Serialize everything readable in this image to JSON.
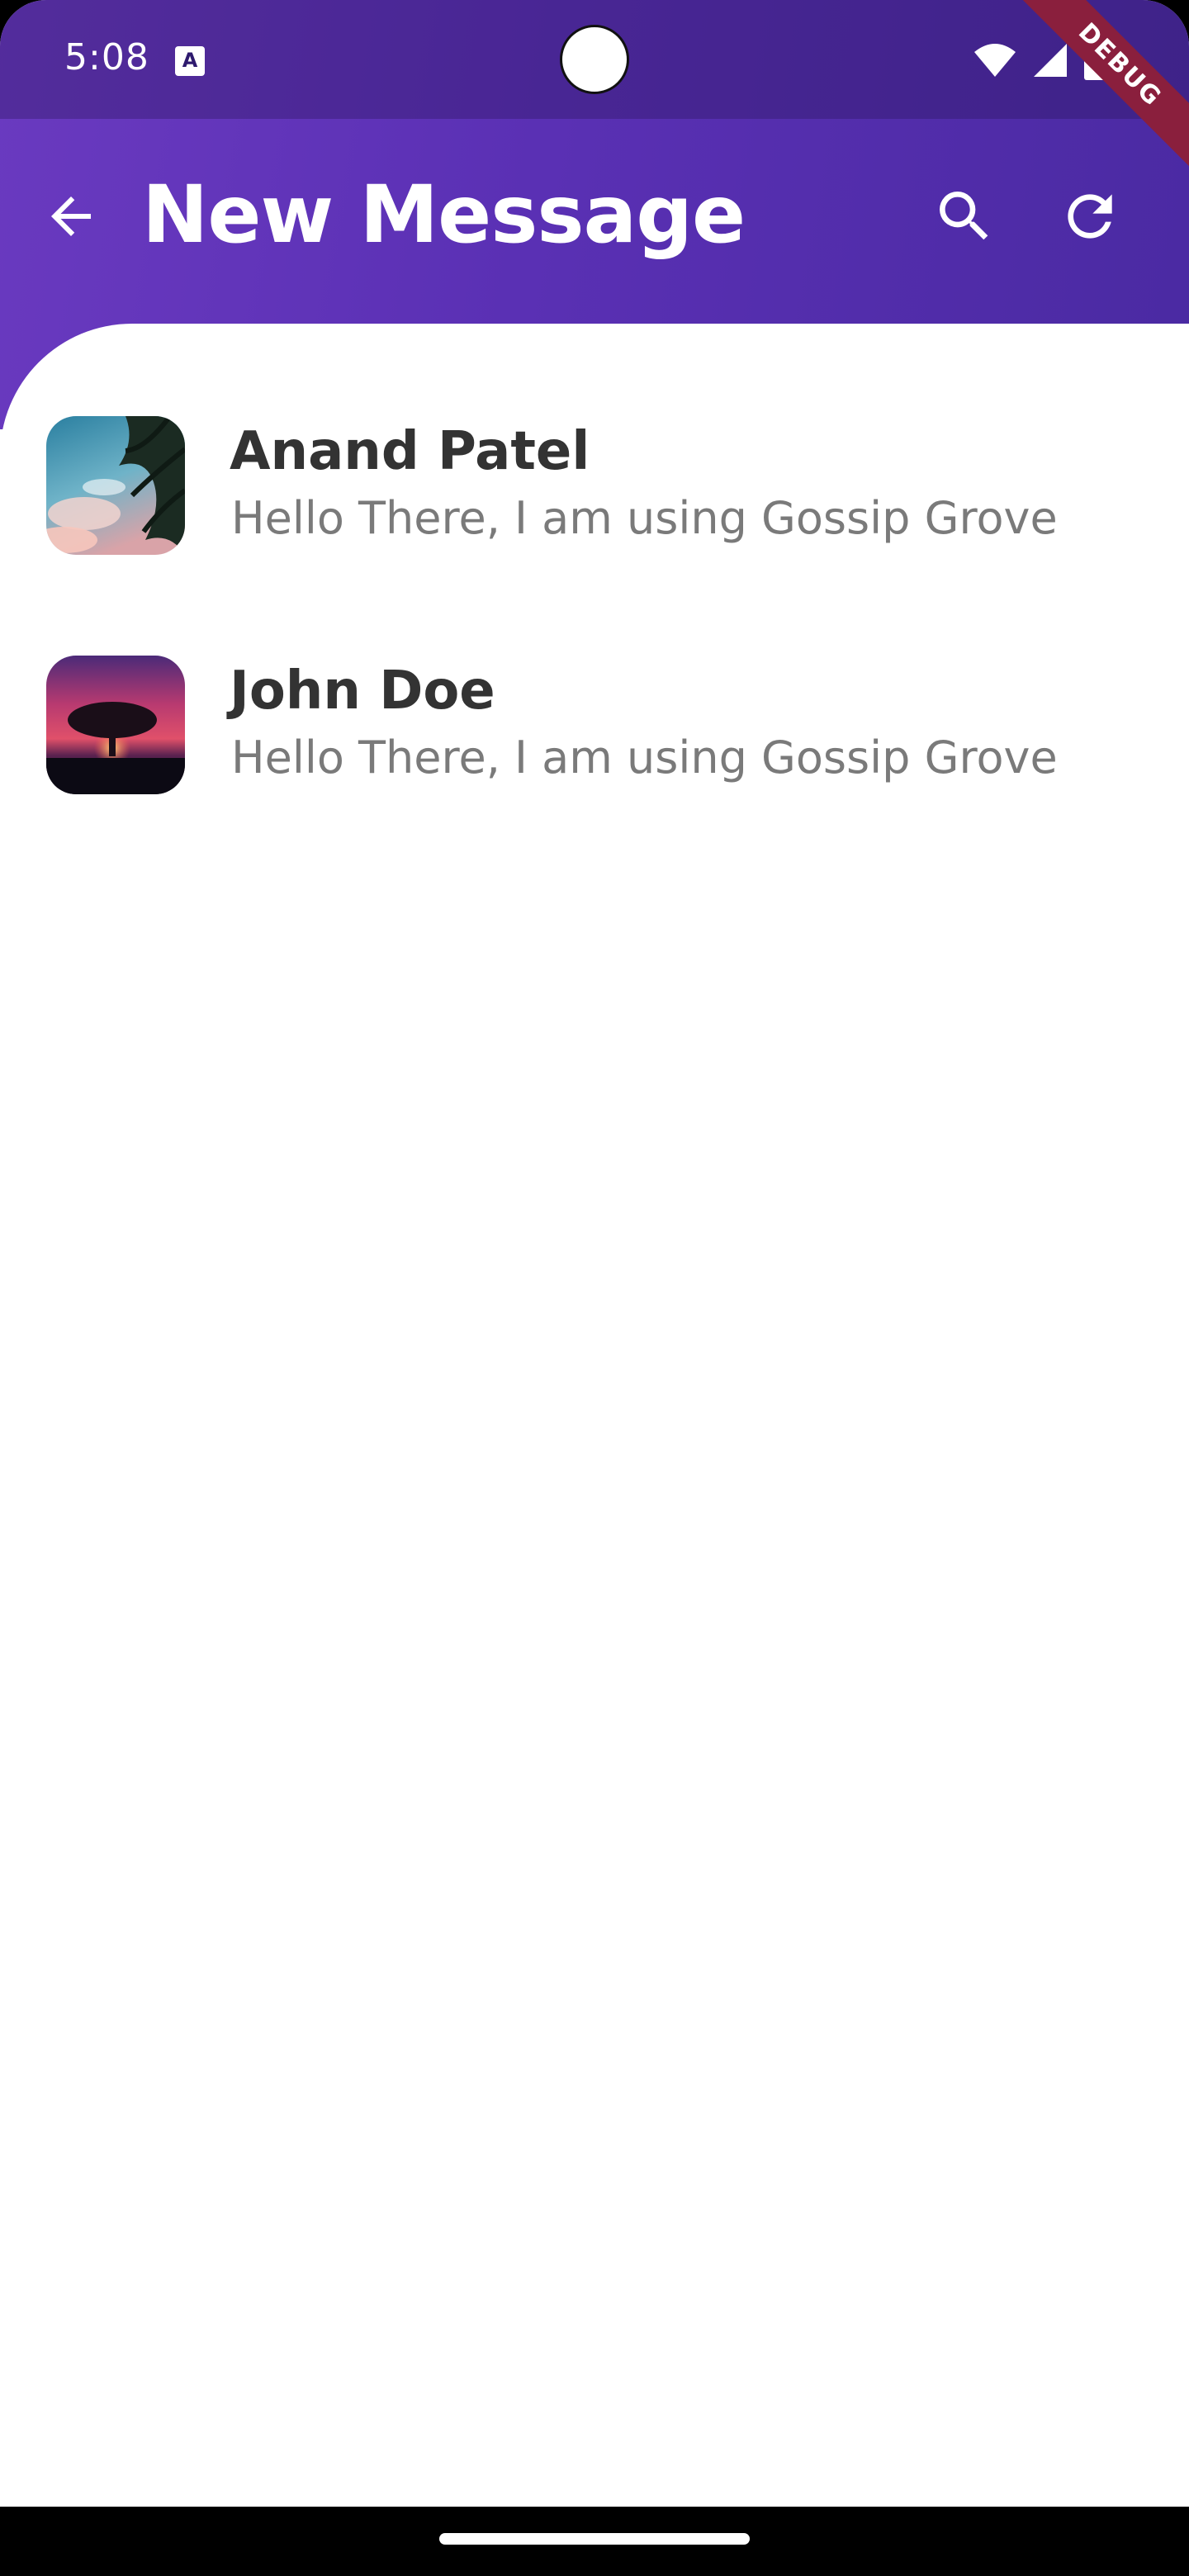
{
  "status_bar": {
    "time": "5:08",
    "badge_letter": "A",
    "debug_label": "DEBUG",
    "icons": [
      "wifi-icon",
      "cellular-signal-icon",
      "battery-icon"
    ]
  },
  "app_bar": {
    "title": "New Message",
    "back_icon": "arrow-back-icon",
    "actions": [
      "search-icon",
      "refresh-icon"
    ],
    "colors": {
      "gradient_start": "#6a3ac0",
      "gradient_end": "#4a2aa2"
    }
  },
  "contacts": [
    {
      "name": "Anand Patel",
      "status": "Hello There, I am using Gossip Grove",
      "avatar": "palm-sky-photo"
    },
    {
      "name": "John Doe",
      "status": "Hello There, I am using Gossip Grove",
      "avatar": "tree-sunset-photo"
    }
  ]
}
